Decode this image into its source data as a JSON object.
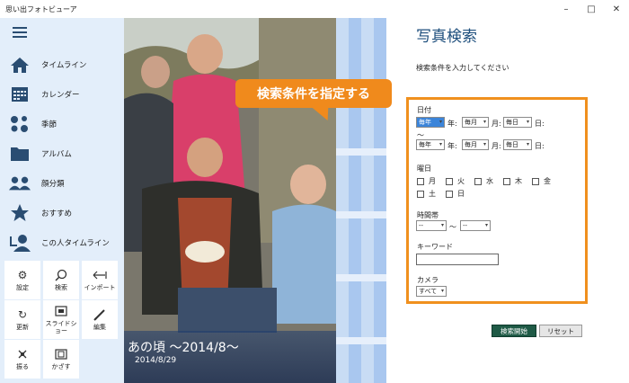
{
  "window": {
    "title": "思い出フォトビューア",
    "minimize": "–",
    "maximize": "□",
    "close": "✕"
  },
  "sidebar": {
    "items": [
      {
        "label": "タイムライン",
        "icon": "home-icon"
      },
      {
        "label": "カレンダー",
        "icon": "calendar-icon"
      },
      {
        "label": "季節",
        "icon": "season-icon"
      },
      {
        "label": "アルバム",
        "icon": "folder-icon"
      },
      {
        "label": "顔分類",
        "icon": "faces-icon"
      },
      {
        "label": "おすすめ",
        "icon": "star-icon"
      },
      {
        "label": "この人タイムライン",
        "icon": "person-timeline-icon"
      }
    ],
    "tiles": [
      {
        "label": "設定",
        "icon": "gear-icon"
      },
      {
        "label": "検索",
        "icon": "search-icon"
      },
      {
        "label": "インポート",
        "icon": "import-icon"
      },
      {
        "label": "更新",
        "icon": "refresh-icon"
      },
      {
        "label": "スライドショー",
        "icon": "slideshow-icon"
      },
      {
        "label": "編集",
        "icon": "pen-icon"
      },
      {
        "label": "振る",
        "icon": "shake-icon"
      },
      {
        "label": "かざす",
        "icon": "hold-icon"
      }
    ]
  },
  "photo": {
    "caption_title": "あの頃 ～2014/8～",
    "caption_date": "2014/8/29"
  },
  "callout": {
    "text": "検索条件を指定する"
  },
  "search": {
    "title": "写真検索",
    "instruction": "検索条件を入力してください",
    "date_label": "日付",
    "year_unit": "年:",
    "month_unit": "月:",
    "day_unit": "日:",
    "range_sep": "～",
    "from": {
      "year": "毎年",
      "month": "毎月",
      "day": "毎日"
    },
    "to": {
      "year": "毎年",
      "month": "毎月",
      "day": "毎日"
    },
    "weekday_label": "曜日",
    "weekdays": [
      "月",
      "火",
      "水",
      "木",
      "金",
      "土",
      "日"
    ],
    "time_label": "時間帯",
    "time_from": "--",
    "time_to": "--",
    "time_sep": "～",
    "keyword_label": "キーワード",
    "keyword_value": "",
    "camera_label": "カメラ",
    "camera_value": "すべて",
    "start_button": "検索開始",
    "reset_button": "リセット"
  },
  "colors": {
    "accent_orange": "#f0901e",
    "title_blue": "#1e4f7d",
    "start_green": "#1f5a46",
    "sidebar_bg": "#e3eefa"
  }
}
